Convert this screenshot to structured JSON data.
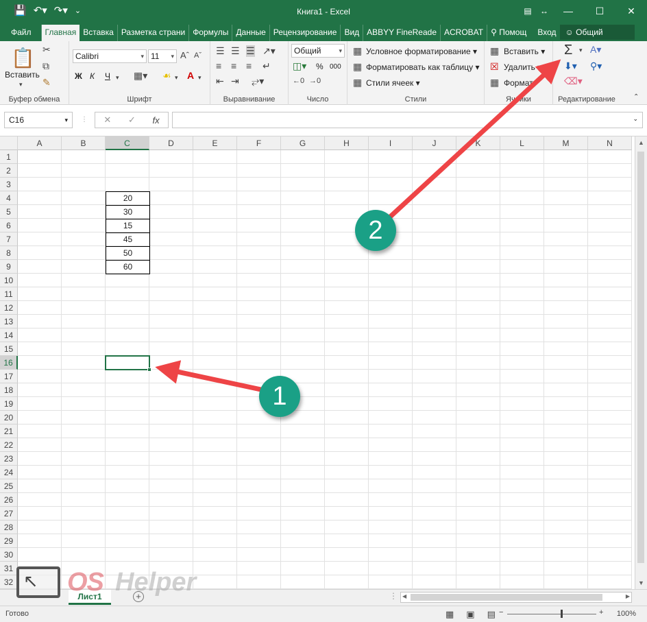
{
  "window": {
    "title": "Книга1 - Excel",
    "qat_icons": [
      "save-icon",
      "undo-icon",
      "redo-icon",
      "customize-icon"
    ],
    "controls": [
      "ribbon-options-icon",
      "restore-size-icon",
      "minimize-icon",
      "maximize-icon",
      "close-icon"
    ]
  },
  "tabs": [
    "Файл",
    "Главная",
    "Вставка",
    "Разметка страни",
    "Формулы",
    "Данные",
    "Рецензирование",
    "Вид",
    "ABBYY FineReade",
    "ACROBAT",
    "Помощ",
    "Вход"
  ],
  "active_tab": "Главная",
  "share_label": "Общий доступ",
  "ribbon": {
    "clipboard": {
      "paste_label": "Вставить",
      "group_label": "Буфер обмена"
    },
    "font": {
      "font_name": "Calibri",
      "font_size": "11",
      "bold": "Ж",
      "italic": "К",
      "underline": "Ч",
      "group_label": "Шрифт"
    },
    "alignment": {
      "group_label": "Выравнивание"
    },
    "number": {
      "format": "Общий",
      "percent": "%",
      "thousands": "000",
      "group_label": "Число"
    },
    "styles": {
      "conditional": "Условное форматирование",
      "format_table": "Форматировать как таблицу",
      "cell_styles": "Стили ячеек",
      "group_label": "Стили"
    },
    "cells": {
      "insert": "Вставить",
      "delete": "Удалить",
      "format": "Формат",
      "group_label": "Ячейки"
    },
    "editing": {
      "group_label": "Редактирование",
      "sum_icon": "Σ"
    }
  },
  "formula_bar": {
    "name_box": "C16",
    "fx": "fx",
    "formula": ""
  },
  "grid": {
    "columns": [
      "A",
      "B",
      "C",
      "D",
      "E",
      "F",
      "G",
      "H",
      "I",
      "J",
      "K",
      "L",
      "M",
      "N"
    ],
    "selected_column": "C",
    "rows": [
      1,
      2,
      3,
      4,
      5,
      6,
      7,
      8,
      9,
      10,
      11,
      12,
      13,
      14,
      15,
      16,
      17,
      18,
      19,
      20,
      21,
      22,
      23,
      24,
      25,
      26,
      27,
      28,
      29,
      30,
      31,
      32
    ],
    "selected_row": 16,
    "values": [
      {
        "cell": "C4",
        "value": "20"
      },
      {
        "cell": "C5",
        "value": "30"
      },
      {
        "cell": "C6",
        "value": "15"
      },
      {
        "cell": "C7",
        "value": "45"
      },
      {
        "cell": "C8",
        "value": "50"
      },
      {
        "cell": "C9",
        "value": "60"
      }
    ],
    "active_cell": "C16"
  },
  "sheet_tabs": [
    "Лист1"
  ],
  "status": {
    "ready": "Готово",
    "zoom": "100%"
  },
  "annotations": [
    {
      "label": "1",
      "color": "#1aa086"
    },
    {
      "label": "2",
      "color": "#1aa086"
    }
  ],
  "arrow_color": "#ee4446",
  "watermark": {
    "text_os": "OS",
    "text_helper": "Helper"
  }
}
